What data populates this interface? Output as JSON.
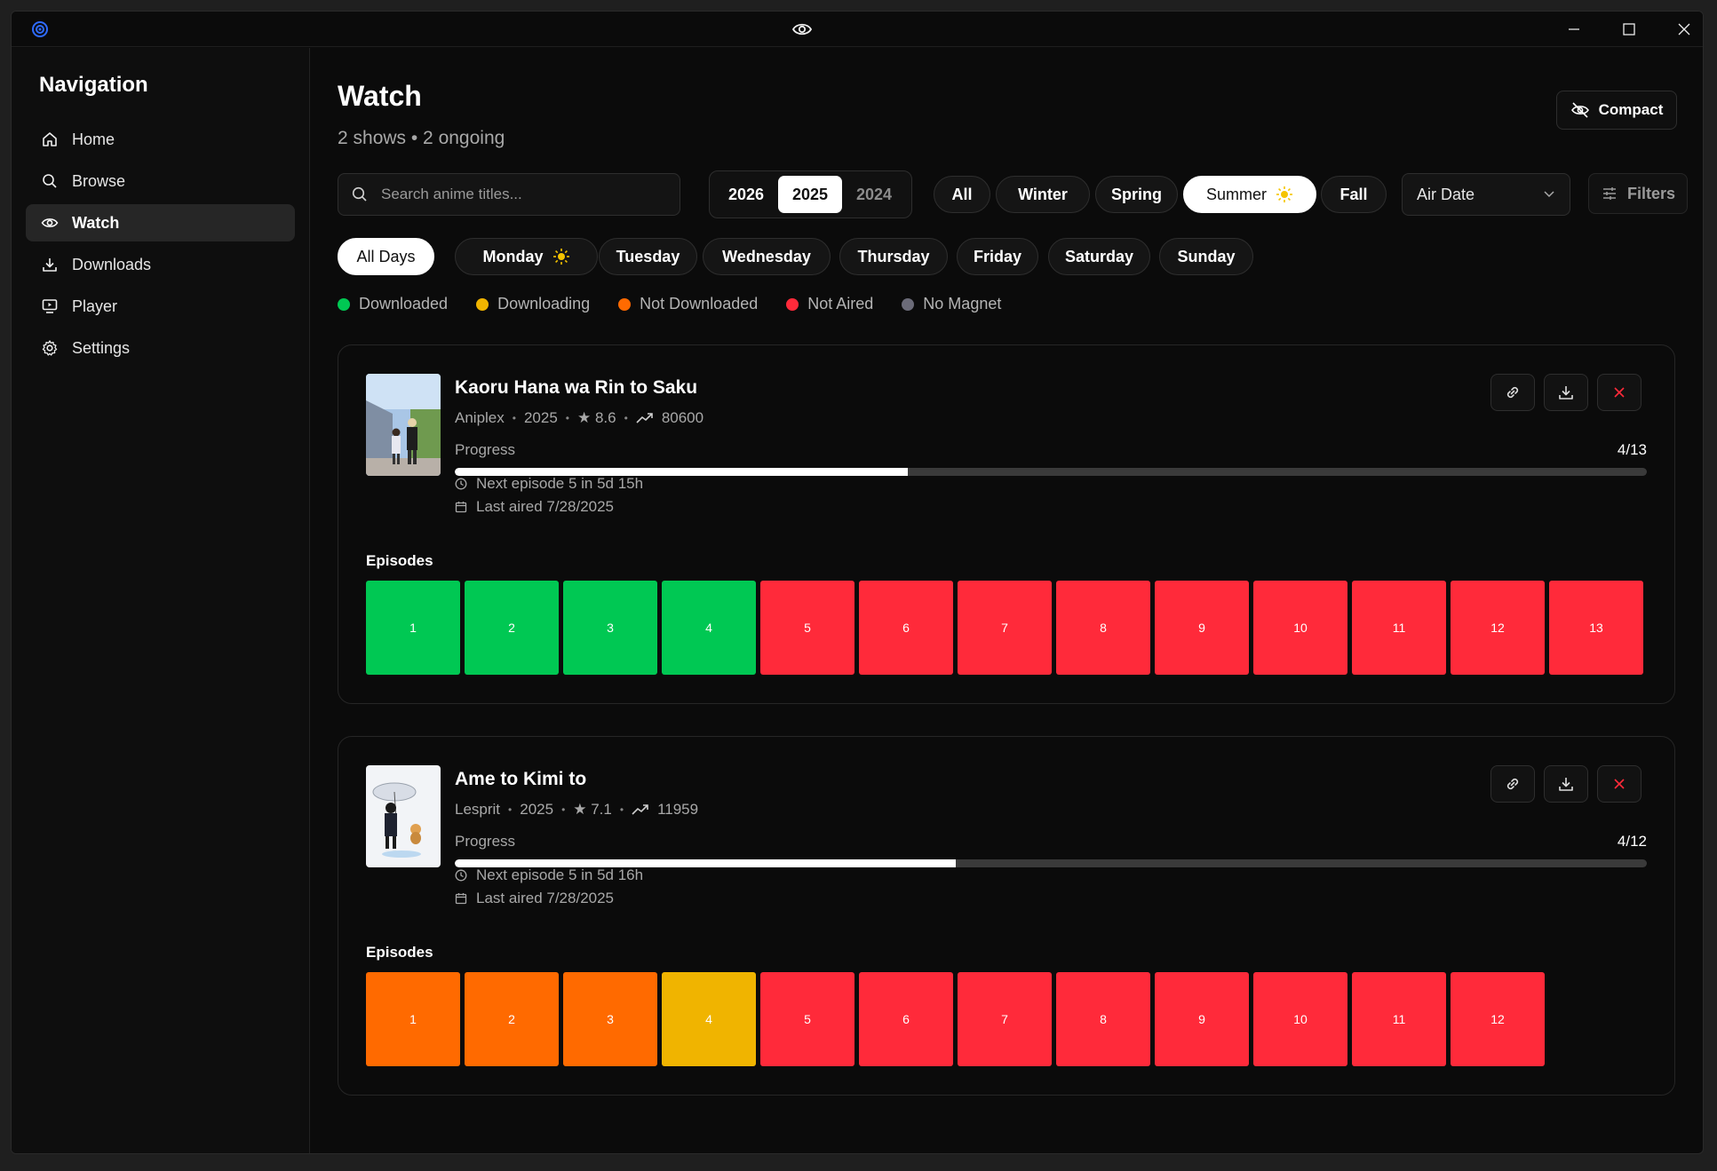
{
  "window": {
    "title_icon": "eye-icon"
  },
  "sidebar": {
    "title": "Navigation",
    "items": [
      {
        "label": "Home",
        "icon": "home-icon"
      },
      {
        "label": "Browse",
        "icon": "search-icon"
      },
      {
        "label": "Watch",
        "icon": "eye-icon",
        "active": true
      },
      {
        "label": "Downloads",
        "icon": "download-icon"
      },
      {
        "label": "Player",
        "icon": "monitor-icon"
      },
      {
        "label": "Settings",
        "icon": "gear-icon"
      }
    ]
  },
  "header": {
    "title": "Watch",
    "subtitle": "2 shows • 2 ongoing",
    "compact_label": "Compact"
  },
  "search": {
    "placeholder": "Search anime titles..."
  },
  "years": [
    "2026",
    "2025",
    "2024"
  ],
  "selected_year": "2025",
  "seasons": [
    "All",
    "Winter",
    "Spring",
    "Summer",
    "Fall"
  ],
  "selected_season": "Summer",
  "sort": {
    "value": "Air Date"
  },
  "filters_label": "Filters",
  "days": [
    "All Days",
    "Monday",
    "Tuesday",
    "Wednesday",
    "Thursday",
    "Friday",
    "Saturday",
    "Sunday"
  ],
  "selected_day": "All Days",
  "legend": [
    {
      "label": "Downloaded",
      "color": "#00c853"
    },
    {
      "label": "Downloading",
      "color": "#f0b400"
    },
    {
      "label": "Not Downloaded",
      "color": "#ff6a00"
    },
    {
      "label": "Not Aired",
      "color": "#ff2a3a"
    },
    {
      "label": "No Magnet",
      "color": "#6b6b78"
    }
  ],
  "colors": {
    "downloaded": "#00c853",
    "downloading": "#f0b400",
    "not_downloaded": "#ff6a00",
    "not_aired": "#ff2a3a"
  },
  "shows": [
    {
      "title": "Kaoru Hana wa Rin to Saku",
      "studio": "Aniplex",
      "year": "2025",
      "rating": "★ 8.6",
      "popularity": "80600",
      "progress_label": "Progress",
      "progress_text": "4/13",
      "progress_fraction": 0.38,
      "next_episode": "Next episode 5 in 5d 15h",
      "last_aired": "Last aired 7/28/2025",
      "episodes_label": "Episodes",
      "episodes": [
        {
          "n": "1",
          "status": "downloaded"
        },
        {
          "n": "2",
          "status": "downloaded"
        },
        {
          "n": "3",
          "status": "downloaded"
        },
        {
          "n": "4",
          "status": "downloaded"
        },
        {
          "n": "5",
          "status": "not_aired"
        },
        {
          "n": "6",
          "status": "not_aired"
        },
        {
          "n": "7",
          "status": "not_aired"
        },
        {
          "n": "8",
          "status": "not_aired"
        },
        {
          "n": "9",
          "status": "not_aired"
        },
        {
          "n": "10",
          "status": "not_aired"
        },
        {
          "n": "11",
          "status": "not_aired"
        },
        {
          "n": "12",
          "status": "not_aired"
        },
        {
          "n": "13",
          "status": "not_aired"
        }
      ]
    },
    {
      "title": "Ame to Kimi to",
      "studio": "Lesprit",
      "year": "2025",
      "rating": "★ 7.1",
      "popularity": "11959",
      "progress_label": "Progress",
      "progress_text": "4/12",
      "progress_fraction": 0.42,
      "next_episode": "Next episode 5 in 5d 16h",
      "last_aired": "Last aired 7/28/2025",
      "episodes_label": "Episodes",
      "episodes": [
        {
          "n": "1",
          "status": "not_downloaded"
        },
        {
          "n": "2",
          "status": "not_downloaded"
        },
        {
          "n": "3",
          "status": "not_downloaded"
        },
        {
          "n": "4",
          "status": "downloading"
        },
        {
          "n": "5",
          "status": "not_aired"
        },
        {
          "n": "6",
          "status": "not_aired"
        },
        {
          "n": "7",
          "status": "not_aired"
        },
        {
          "n": "8",
          "status": "not_aired"
        },
        {
          "n": "9",
          "status": "not_aired"
        },
        {
          "n": "10",
          "status": "not_aired"
        },
        {
          "n": "11",
          "status": "not_aired"
        },
        {
          "n": "12",
          "status": "not_aired"
        }
      ]
    }
  ]
}
